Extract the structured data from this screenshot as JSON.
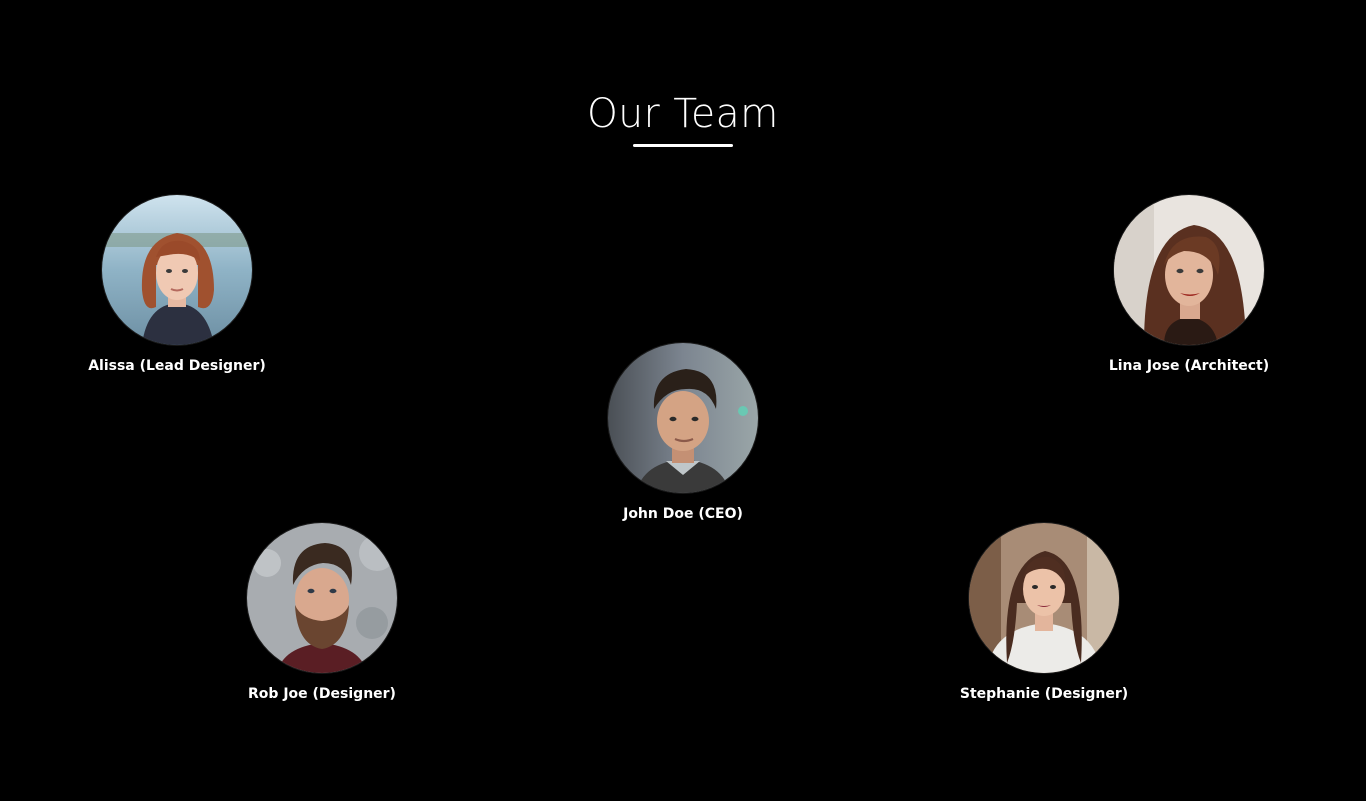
{
  "header": {
    "title": "Our Team"
  },
  "team": [
    {
      "id": "alissa",
      "name": "Alissa (Lead Designer)",
      "avatar_icon": "person-portrait"
    },
    {
      "id": "lina",
      "name": "Lina Jose (Architect)",
      "avatar_icon": "person-portrait"
    },
    {
      "id": "john",
      "name": "John Doe (CEO)",
      "avatar_icon": "person-portrait"
    },
    {
      "id": "rob",
      "name": "Rob Joe (Designer)",
      "avatar_icon": "person-portrait"
    },
    {
      "id": "stephanie",
      "name": "Stephanie (Designer)",
      "avatar_icon": "person-portrait"
    }
  ],
  "colors": {
    "background": "#000000",
    "text": "#ffffff"
  }
}
